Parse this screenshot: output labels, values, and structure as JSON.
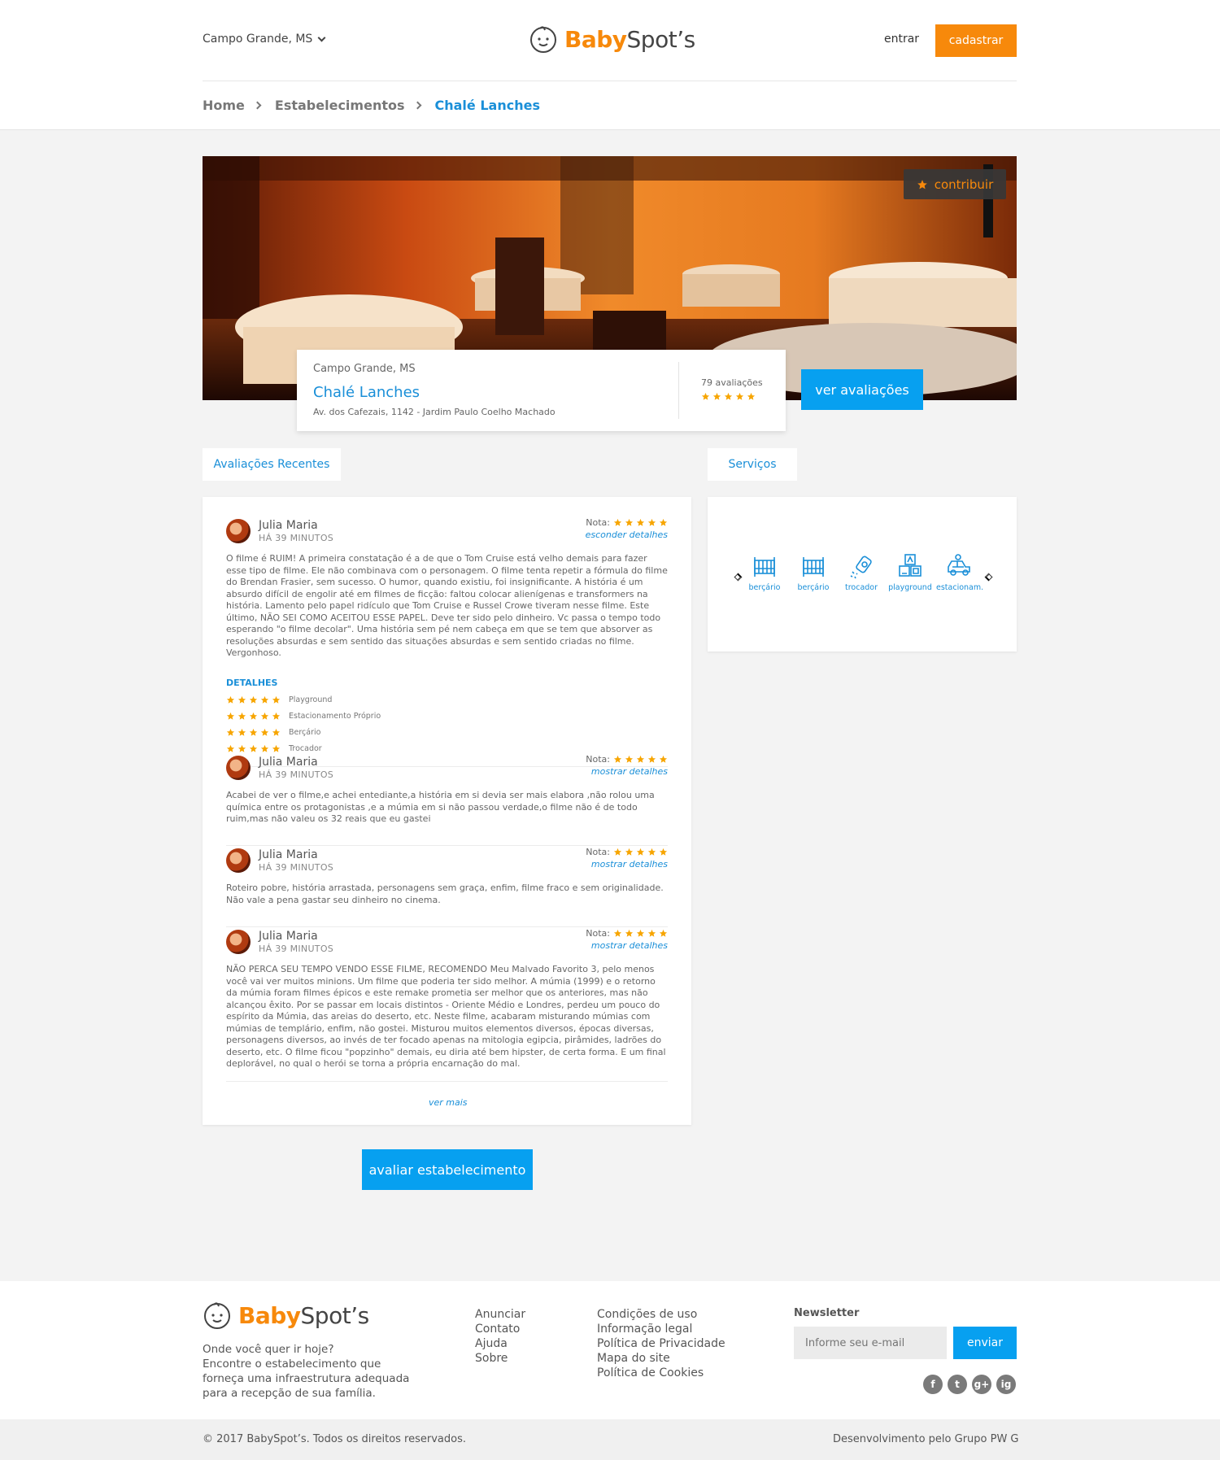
{
  "header": {
    "city": "Campo Grande, MS",
    "logo": {
      "part1": "Baby",
      "part2": "Spot’s"
    },
    "login": "entrar",
    "signup": "cadastrar"
  },
  "breadcrumb": [
    "Home",
    "Estabelecimentos",
    "Chalé Lanches"
  ],
  "hero": {
    "contribute": "contribuir",
    "city": "Campo  Grande, MS",
    "name": "Chalé Lanches",
    "address": "Av. dos Cafezais, 1142 - Jardim Paulo Coelho Machado",
    "reviews_count": "79 avaliações",
    "rating": 5,
    "see_reviews": "ver avaliações"
  },
  "tabs": {
    "reviews": "Avaliações Recentes",
    "services": "Serviços"
  },
  "reviews": [
    {
      "name": "Julia Maria",
      "time": "HÁ 39 MINUTOS",
      "nota_label": "Nota:",
      "rating": 5,
      "toggle": "esconder detalhes",
      "text": "O filme é RUIM! A primeira constatação é a de que o Tom Cruise está velho demais para fazer esse tipo de filme. Ele não combinava com o personagem. O filme tenta repetir a fórmula do filme do Brendan Frasier, sem sucesso. O humor, quando existiu, foi insignificante. A história é um absurdo difícil de engolir até em filmes de ficção: faltou colocar alienígenas e transformers na história. Lamento pelo papel ridículo que Tom Cruise e Russel Crowe tiveram nesse filme. Este último, NÃO SEI COMO ACEITOU ESSE PAPEL. Deve ter sido pelo dinheiro. Vc passa o tempo todo esperando \"o filme decolar\". Uma história sem pé nem cabeça em que se tem que absorver as resoluções absurdas e sem sentido das situações absurdas e sem sentido criadas no filme. Vergonhoso.",
      "details_title": "DETALHES",
      "details": [
        {
          "label": "Playground",
          "rating": 5
        },
        {
          "label": "Estacionamento Próprio",
          "rating": 5
        },
        {
          "label": "Berçário",
          "rating": 5
        },
        {
          "label": "Trocador",
          "rating": 5
        }
      ]
    },
    {
      "name": "Julia Maria",
      "time": "HÁ 39 MINUTOS",
      "nota_label": "Nota:",
      "rating": 5,
      "toggle": "mostrar detalhes",
      "text": "Acabei de ver o filme,e achei entediante,a história em si devia ser mais elabora ,não rolou uma química entre os protagonistas ,e a múmia em si não passou verdade,o filme não é de todo ruim,mas não valeu os 32 reais que eu gastei"
    },
    {
      "name": "Julia Maria",
      "time": "HÁ 39 MINUTOS",
      "nota_label": "Nota:",
      "rating": 5,
      "toggle": "mostrar detalhes",
      "text": "Roteiro pobre, história arrastada, personagens sem graça, enfim, filme fraco e sem originalidade. Não vale a pena gastar seu dinheiro no cinema."
    },
    {
      "name": "Julia Maria",
      "time": "HÁ 39 MINUTOS",
      "nota_label": "Nota:",
      "rating": 5,
      "toggle": "mostrar detalhes",
      "text": "NÃO PERCA SEU TEMPO VENDO ESSE FILME, RECOMENDO Meu Malvado Favorito 3, pelo menos você vai ver muitos minions. Um filme que poderia ter sido melhor. A múmia (1999) e o retorno da múmia foram filmes épicos e este remake prometia ser melhor que os anteriores, mas não alcançou êxito. Por se passar em locais distintos - Oriente Médio e Londres, perdeu um pouco do espírito da Múmia, das areias do deserto, etc. Neste filme, acabaram misturando múmias com múmias de templário, enfim, não gostei. Misturou muitos elementos diversos, épocas diversas, personagens diversos, ao invés de ter focado apenas na mitologia egipcia, pirâmides, ladrões do deserto, etc. O filme ficou \"popzinho\" demais, eu diria até bem hipster, de certa forma. E um final deplorável, no qual o herói se torna a própria encarnação do mal."
    }
  ],
  "see_more": "ver mais",
  "rate_button": "avaliar estabelecimento",
  "services": [
    {
      "label": "berçário",
      "icon": "crib-icon"
    },
    {
      "label": "berçário",
      "icon": "crib-icon"
    },
    {
      "label": "trocador",
      "icon": "powder-icon"
    },
    {
      "label": "playground",
      "icon": "blocks-icon"
    },
    {
      "label": "estacionam.",
      "icon": "car-icon"
    }
  ],
  "footer": {
    "tagline": "Onde você quer ir hoje?\nEncontre o estabelecimento que forneça uma infraestrutura adequada para a recepção de sua família.",
    "col1": [
      "Anunciar",
      "Contato",
      "Ajuda",
      "Sobre"
    ],
    "col2": [
      "Condições de uso",
      "Informação legal",
      "Política de Privacidade",
      "Mapa do site",
      "Política de Cookies"
    ],
    "newsletter_title": "Newsletter",
    "newsletter_placeholder": "Informe seu e-mail",
    "newsletter_button": "enviar",
    "socials": [
      "f",
      "t",
      "g+",
      "ig"
    ],
    "copyright": "© 2017 BabySpot’s. Todos os direitos reservados.",
    "developer": "Desenvolvimento pelo Grupo  PW  G"
  },
  "colors": {
    "accent": "#f7890b",
    "primary": "#07a0f0",
    "link": "#1a8fd8"
  }
}
